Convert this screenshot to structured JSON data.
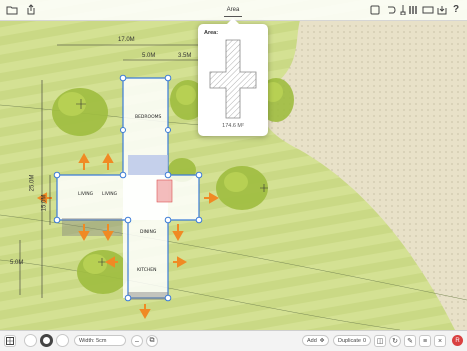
{
  "colors": {
    "accent": "#3b7bd6",
    "arrow": "#f08a24",
    "record": "#d94040",
    "lawn": "#cfdc8a",
    "sand": "#e8e1c8"
  },
  "toolbar": {
    "folder_icon": "folder-icon",
    "share_icon": "share-icon",
    "area_label": "Area",
    "right_icons": [
      "calculator-icon",
      "undo-icon",
      "brush-icon",
      "pencils-icon",
      "layers-icon",
      "import-icon",
      "help-icon"
    ],
    "help_label": "?"
  },
  "area_popup": {
    "title": "Area:",
    "value": "174.6 M²"
  },
  "dimensions": {
    "top_width": "17.0M",
    "left_segment": "5.0M",
    "right_segment": "3.5M",
    "height_outer": "25.0M",
    "height_inner": "15.0M",
    "small_left": "5.0M"
  },
  "room_labels": {
    "bedrooms": "BEDROOMS",
    "living": "LIVING",
    "living2": "LIVING",
    "dining": "DINING",
    "kitchen": "KITCHEN"
  },
  "bottombar": {
    "width_label": "Width: 5cm",
    "add_label": "Add",
    "duplicate_label": "Duplicate",
    "duplicate_count": "0",
    "record_label": "R"
  }
}
